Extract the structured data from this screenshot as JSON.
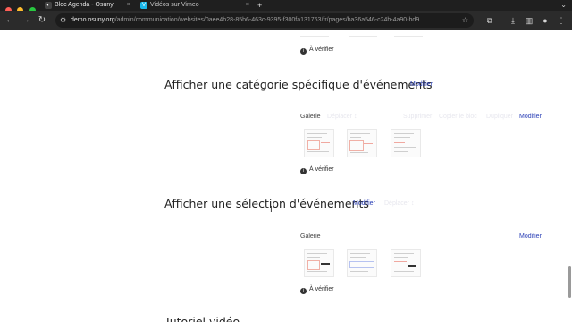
{
  "browser": {
    "tabs": [
      {
        "title": "Bloc Agenda - Osuny",
        "active": true
      },
      {
        "title": "Vidéos sur Vimeo",
        "active": false
      }
    ],
    "url_host": "demo.osuny.org",
    "url_path": "/admin/communication/websites/0aee4b28-85b6-463c-9395-f300fa131763/fr/pages/ba36a546-c24b-4a90-bd9..."
  },
  "page": {
    "verify_label": "À vérifier",
    "sections": [
      {
        "title": "Afficher une catégorie spécifique d'événements",
        "edit": "Modifier",
        "faint_after_title": "",
        "gallery_label": "Galerie",
        "gallery_faint": "Déplacer ↕",
        "gallery_actions_faint": [
          "Supprimer",
          "Copier le bloc",
          "Dupliquer"
        ],
        "gallery_edit": "Modifier"
      },
      {
        "title": "Afficher une sélection d'événements",
        "edit": "Modifier",
        "faint_after_title": "Déplacer ↕",
        "gallery_label": "Galerie",
        "gallery_edit": "Modifier"
      }
    ],
    "next_title": "Tutoriel vidéo"
  },
  "colors": {
    "accent_link": "#2a3fb6",
    "tab_bg": "#1f1f1f",
    "toolbar_bg": "#2b2b2b"
  },
  "icons": [
    "back-icon",
    "forward-icon",
    "reload-icon",
    "tune-icon",
    "star-icon",
    "extensions-icon",
    "sidepanel-icon",
    "profile-icon",
    "menu-icon",
    "info-icon"
  ]
}
